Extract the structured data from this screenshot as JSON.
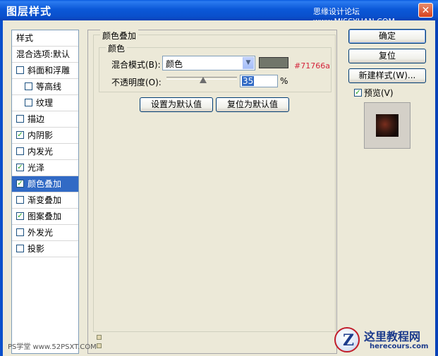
{
  "window": {
    "title": "图层样式",
    "watermark": "思缘设计论坛 www.MISSYUAN.COM",
    "close_symbol": "✕"
  },
  "sidebar": {
    "header": "样式",
    "blend_options": "混合选项:默认",
    "items": [
      {
        "label": "斜面和浮雕",
        "checked": false,
        "indent": 0
      },
      {
        "label": "等高线",
        "checked": false,
        "indent": 1
      },
      {
        "label": "纹理",
        "checked": false,
        "indent": 1
      },
      {
        "label": "描边",
        "checked": false,
        "indent": 0
      },
      {
        "label": "内阴影",
        "checked": true,
        "indent": 0
      },
      {
        "label": "内发光",
        "checked": false,
        "indent": 0
      },
      {
        "label": "光泽",
        "checked": true,
        "indent": 0
      },
      {
        "label": "颜色叠加",
        "checked": true,
        "indent": 0,
        "selected": true
      },
      {
        "label": "渐变叠加",
        "checked": false,
        "indent": 0
      },
      {
        "label": "图案叠加",
        "checked": true,
        "indent": 0
      },
      {
        "label": "外发光",
        "checked": false,
        "indent": 0
      },
      {
        "label": "投影",
        "checked": false,
        "indent": 0
      }
    ]
  },
  "main": {
    "section_title": "颜色叠加",
    "group_title": "颜色",
    "blend_mode_label": "混合模式(B):",
    "blend_mode_value": "颜色",
    "swatch_color": "#71766a",
    "swatch_hex": "#71766a",
    "opacity_label": "不透明度(O):",
    "opacity_value": "35",
    "opacity_fraction": 0.35,
    "opacity_unit": "%",
    "set_default_label": "设置为默认值",
    "reset_default_label": "复位为默认值"
  },
  "actions": {
    "ok_label": "确定",
    "reset_label": "复位",
    "new_style_label": "新建样式(W)...",
    "preview_label": "预览(V)",
    "preview_checked": true
  },
  "footer": {
    "left_watermark": "PS学堂 www.52PSXT.COM",
    "logo_cn": "这里教程网",
    "logo_en": "herecours.com",
    "logo_letter": "Z"
  },
  "colors": {
    "titlebar": "#0A58D8",
    "selection": "#316AC5",
    "hex_text": "#D4243B"
  }
}
